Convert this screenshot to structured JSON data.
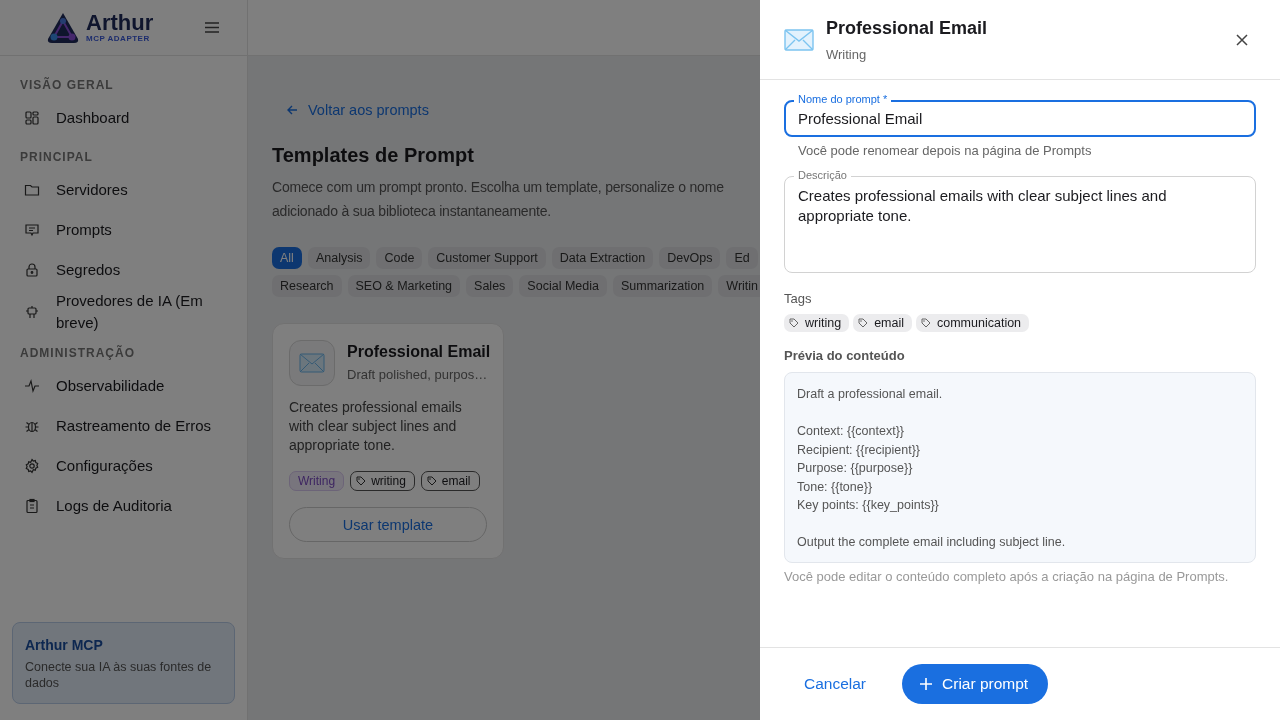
{
  "sidebar": {
    "logo": {
      "name": "Arthur",
      "tagline": "MCP ADAPTER"
    },
    "sections": [
      {
        "heading": "VISÃO GERAL",
        "items": [
          "Dashboard"
        ]
      },
      {
        "heading": "PRINCIPAL",
        "items": [
          "Servidores",
          "Prompts",
          "Segredos",
          "Provedores de IA (Em breve)"
        ]
      },
      {
        "heading": "ADMINISTRAÇÃO",
        "items": [
          "Observabilidade",
          "Rastreamento de Erros",
          "Configurações",
          "Logs de Auditoria"
        ]
      }
    ],
    "promo": {
      "title": "Arthur MCP",
      "text": "Conecte sua IA às suas fontes de dados"
    }
  },
  "main": {
    "back_link": "Voltar aos prompts",
    "title": "Templates de Prompt",
    "description_lines": [
      "Comece com um prompt pronto. Escolha um template, personalize o nome",
      "adicionado à sua biblioteca instantaneamente."
    ],
    "category_rows": [
      [
        {
          "label": "All",
          "selected": true
        },
        {
          "label": "Analysis",
          "selected": false
        },
        {
          "label": "Code",
          "selected": false
        },
        {
          "label": "Customer Support",
          "selected": false
        },
        {
          "label": "Data Extraction",
          "selected": false
        },
        {
          "label": "DevOps",
          "selected": false
        },
        {
          "label": "Ed",
          "selected": false
        }
      ],
      [
        {
          "label": "Research",
          "selected": false
        },
        {
          "label": "SEO & Marketing",
          "selected": false
        },
        {
          "label": "Sales",
          "selected": false
        },
        {
          "label": "Social Media",
          "selected": false
        },
        {
          "label": "Summarization",
          "selected": false
        },
        {
          "label": "Writin",
          "selected": false
        }
      ]
    ],
    "card": {
      "title": "Professional Email",
      "subtitle": "Draft polished, purpos…",
      "description": "Creates professional emails with clear subject lines and appropriate tone.",
      "category": "Writing",
      "tags": [
        "writing",
        "email"
      ],
      "button": "Usar template"
    }
  },
  "drawer": {
    "title": "Professional Email",
    "subtitle": "Writing",
    "name_field": {
      "label": "Nome do prompt *",
      "value": "Professional Email",
      "helper": "Você pode renomear depois na página de Prompts"
    },
    "description_field": {
      "label": "Descrição",
      "value": "Creates professional emails with clear subject lines and appropriate tone."
    },
    "tags_label": "Tags",
    "tags": [
      "writing",
      "email",
      "communication"
    ],
    "preview_label": "Prévia do conteúdo",
    "preview": "Draft a professional email.\n\nContext: {{context}}\nRecipient: {{recipient}}\nPurpose: {{purpose}}\nTone: {{tone}}\nKey points: {{key_points}}\n\nOutput the complete email including subject line.",
    "preview_note": "Você pode editar o conteúdo completo após a criação na página de Prompts.",
    "cancel_button": "Cancelar",
    "create_button": "Criar prompt"
  }
}
